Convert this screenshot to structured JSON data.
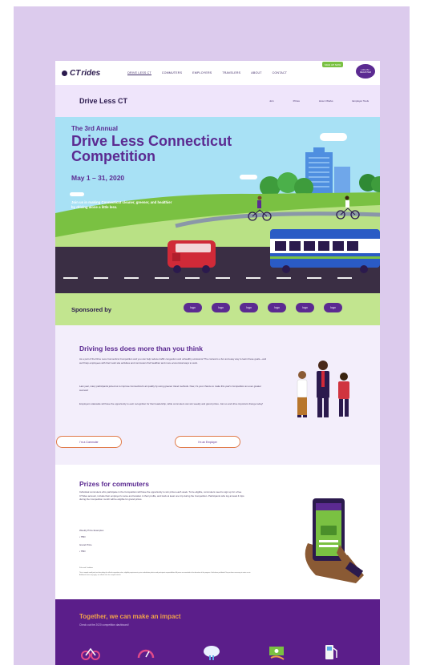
{
  "brand": {
    "logo_text": "CT",
    "logo_text_italic": "rides"
  },
  "topnav": {
    "links": [
      "DRIVE LESS CT",
      "COMMUTERS",
      "EMPLOYERS",
      "TRAVELERS",
      "ABOUT",
      "CONTACT"
    ],
    "active_index": 0,
    "cta_label": "SIGN UP NOW",
    "login_label": "LOG IN / REGISTER"
  },
  "subnav": {
    "title": "Drive Less CT",
    "links": [
      "Join",
      "Prizes",
      "How it Works",
      "Employer Tools"
    ]
  },
  "hero": {
    "annual": "The 3rd Annual",
    "title": "Drive Less Connecticut Competition",
    "dates": "May 1 – 31, 2020",
    "join_text": "Join us in making Connecticut cleaner, greener, and healthier by driving alone a little less."
  },
  "sponsor": {
    "label": "Sponsored by",
    "logos": [
      "logo",
      "logo",
      "logo",
      "logo",
      "logo",
      "logo"
    ]
  },
  "driving": {
    "heading": "Driving less does more than you think",
    "p1": "As a part of the Drive Less Connecticut Competition and you can help reduce traffic congestion and unhealthy emissions! The contest is a fun and easy way to learn these goals—and we'll help employees with their work site activities and commuters find healthier and more economical ways to work.",
    "p2": "Last year, many participants joined us to improve Connecticut's air quality by using greener travel methods. Now, it's your chance to make this year's Competition an even greater success!",
    "p3": "Employers statewide will have the opportunity to earn recognition for their leadership, while commuters can win weekly and grand prizes. Join us and drive important change today!",
    "btn_commuter": "I'm a Commuter",
    "btn_employer": "I'm an Employer"
  },
  "prizes": {
    "heading": "Prizes for commuters",
    "intro": "Individual commuters who participate in the Competition will have the opportunity to win prizes each week. To be eligible, commuters need to sign up for a free CTrides account, include their employer's name and location in their profile, and track at least one trip during the Competition. Participants who log at least 4 trips during the Competition month will be eligible for grand prizes.",
    "weekly_label": "Weekly Prize Examples",
    "weekly_item": "• TBD",
    "grand_label": "Grand Prize",
    "grand_item": "• TBD",
    "fine_heading": "Rules and Conditions",
    "fine_text": "This is sample small print text describing the official competition rules, eligibility requirements, prize substitution policies and participant responsibilities. All prizes are awarded at the discretion of the program. Void where prohibited. No purchase necessary to enter or win. Additional terms may apply; see official rules for complete details."
  },
  "impact": {
    "heading": "Together, we can make an impact",
    "sub": "Check out the 2020 competition dashboard!"
  },
  "colors": {
    "purple": "#5b2a91",
    "green": "#7ac142",
    "light_green": "#c2e58f",
    "sky": "#a8e1f5",
    "orange": "#e07a48"
  }
}
